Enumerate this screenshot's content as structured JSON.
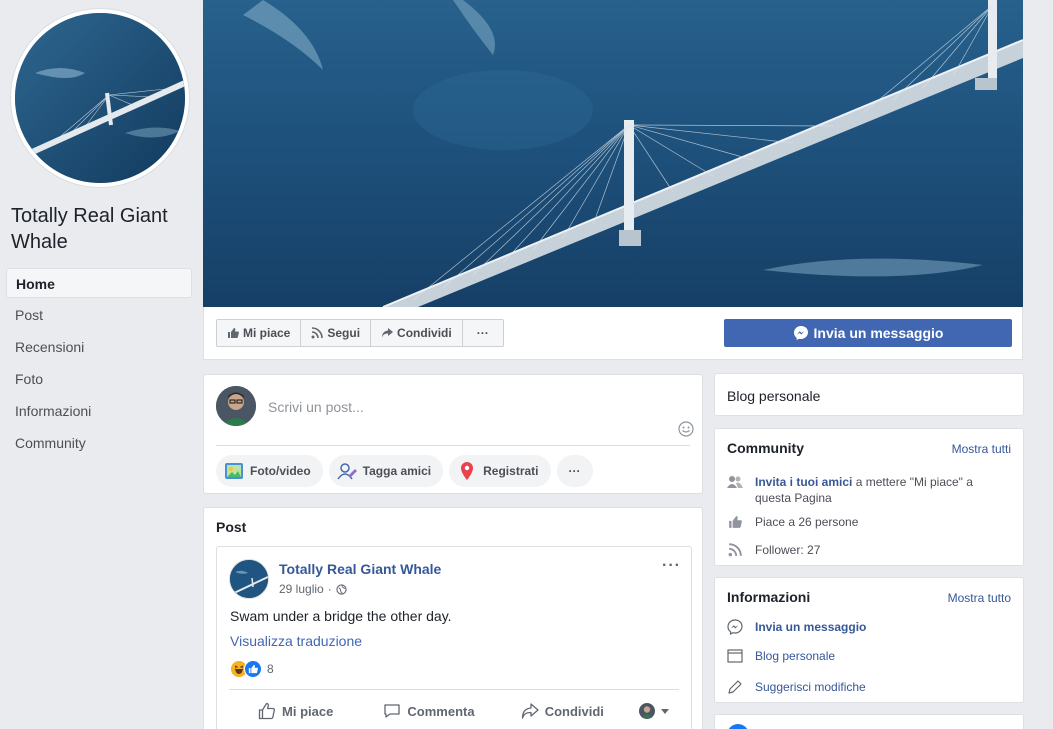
{
  "page": {
    "name": "Totally Real Giant Whale"
  },
  "nav": {
    "items": [
      {
        "label": "Home",
        "active": true
      },
      {
        "label": "Post"
      },
      {
        "label": "Recensioni"
      },
      {
        "label": "Foto"
      },
      {
        "label": "Informazioni"
      },
      {
        "label": "Community"
      }
    ]
  },
  "actions": {
    "like": "Mi piace",
    "follow": "Segui",
    "share": "Condividi",
    "more": "···",
    "message": "Invia un messaggio"
  },
  "composer": {
    "placeholder": "Scrivi un post...",
    "photo": "Foto/video",
    "tag": "Tagga amici",
    "checkin": "Registrati",
    "more": "···"
  },
  "posts": {
    "title": "Post",
    "item": {
      "author": "Totally Real Giant Whale",
      "date": "29 luglio",
      "date_sep": "·",
      "text": "Swam under a bridge the other day.",
      "translate": "Visualizza traduzione",
      "reaction_count": "8",
      "menu": "···",
      "like": "Mi piace",
      "comment": "Commenta",
      "share": "Condividi"
    }
  },
  "sidebar": {
    "category": "Blog personale",
    "community": {
      "title": "Community",
      "see_all": "Mostra tutti",
      "invite_link": "Invita i tuoi amici",
      "invite_rest": " a mettere \"Mi piace\" a questa Pagina",
      "likes": "Piace a 26 persone",
      "followers": "Follower: 27"
    },
    "about": {
      "title": "Informazioni",
      "see_all": "Mostra tutto",
      "message": "Invia un messaggio",
      "category": "Blog personale",
      "suggest": "Suggerisci modifiche"
    }
  },
  "colors": {
    "brand": "#4267b2",
    "link": "#365899",
    "background": "#e9ebee"
  }
}
